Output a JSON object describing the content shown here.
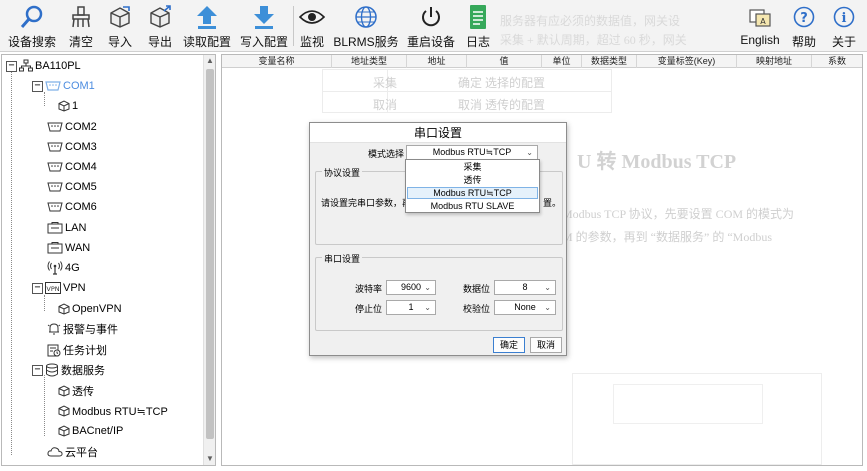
{
  "toolbar": {
    "items": [
      {
        "label": "设备搜索",
        "icon": "magnifier-icon"
      },
      {
        "label": "清空",
        "icon": "broom-icon"
      },
      {
        "label": "导入",
        "icon": "box-in-icon"
      },
      {
        "label": "导出",
        "icon": "box-out-icon"
      },
      {
        "label": "读取配置",
        "icon": "arrow-up-icon"
      },
      {
        "label": "写入配置",
        "icon": "arrow-down-icon"
      },
      {
        "label": "监视",
        "icon": "eye-icon"
      },
      {
        "label": "BLRMS服务",
        "icon": "globe-icon"
      },
      {
        "label": "重启设备",
        "icon": "power-icon"
      },
      {
        "label": "日志",
        "icon": "log-icon"
      },
      {
        "label": "English",
        "icon": "language-icon"
      },
      {
        "label": "帮助",
        "icon": "help-icon"
      },
      {
        "label": "关于",
        "icon": "info-icon"
      }
    ]
  },
  "tree": {
    "root": "BA110PL",
    "com1": "COM1",
    "com1_child": "1",
    "com2": "COM2",
    "com3": "COM3",
    "com4": "COM4",
    "com5": "COM5",
    "com6": "COM6",
    "lan": "LAN",
    "wan": "WAN",
    "g4": "4G",
    "vpn": "VPN",
    "openvpn": "OpenVPN",
    "alarm": "报警与事件",
    "task": "任务计划",
    "dataservice": "数据服务",
    "passthrough": "透传",
    "modbus": "Modbus RTU≒TCP",
    "bacnet": "BACnet/IP",
    "cloud": "云平台"
  },
  "table": {
    "columns": [
      "变量名称",
      "地址类型",
      "地址",
      "值",
      "单位",
      "数据类型",
      "变量标签(Key)",
      "映射地址",
      "系数"
    ]
  },
  "background_text": {
    "line1": "服务器有应必须的数据值，网关设",
    "line2": "采集 + 默认周期，超过 60 秒，网关",
    "row1_label": "采集",
    "row1_value": "确定 选择的配置",
    "row2_label": "取消",
    "row2_value": "取消 透传的配置",
    "heading": "U 转 Modbus TCP",
    "para1": "Modbus TCP 协议，先要设置 COM 的模式为",
    "para2": "M 的参数，再到 “数据服务” 的 “Modbus"
  },
  "dialog": {
    "title": "串口设置",
    "mode_label": "模式选择",
    "mode_value": "Modbus RTU≒TCP",
    "mode_options": [
      "采集",
      "透传",
      "Modbus RTU≒TCP",
      "Modbus RTU SLAVE"
    ],
    "protocol_group": "协议设置",
    "protocol_hint_left": "请设置完串口参数，再到",
    "protocol_hint_right": "置。",
    "serial_group": "串口设置",
    "baud_label": "波特率",
    "baud_value": "9600",
    "databits_label": "数据位",
    "databits_value": "8",
    "stopbits_label": "停止位",
    "stopbits_value": "1",
    "parity_label": "校验位",
    "parity_value": "None",
    "ok": "确定",
    "cancel": "取消"
  },
  "colors": {
    "accent": "#4d8de0",
    "selection": "#e5f1fb"
  }
}
